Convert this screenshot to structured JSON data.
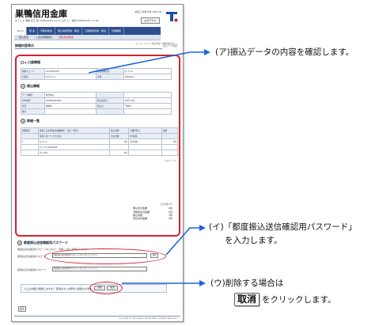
{
  "screen": {
    "bank_name": "巣鴨信用金庫",
    "header_small": "前回ご利用日時 WEB-TB",
    "sub_info": "ようこそ 巣鴨 花子 様 2008/04/02 14:14 ログイン 前回 2008/04/01 12:30",
    "logout_label": "ログアウト",
    "nav": [
      "メイン",
      "照 会",
      "手数料照会",
      "振込情報登録・照会",
      "口座振替登録・照会",
      "管理機能"
    ],
    "subnav": [
      "・振込照会",
      "・入金先明細照会",
      "・振込取消照会"
    ],
    "page_title": "詳細内容表示",
    "breadcrumb": "ホーム＞メイン＞振込照会＞詳細内容表示 ＞振込データ削除",
    "sections": {
      "account": {
        "title": "口座情報",
        "rows": [
          [
            "依頼人コード",
            "0123456789",
            "振込依頼者名",
            "ｽｶﾞﾓ ﾊﾅｺ"
          ],
          [
            "企業名",
            "ｶ)ｽｶﾞﾓｼﾝｷﾝ",
            "普通",
            "0000123"
          ]
        ]
      },
      "transfer": {
        "num": "1",
        "title": "振込情報",
        "rows": [
          [
            "データ種別",
            "総合振込",
            "",
            ""
          ],
          [
            "WEB番号",
            "200804020001",
            "振込指定日",
            "04月 05日"
          ],
          [
            "状況",
            "依頼中",
            "振込日",
            "予約済"
          ],
          [
            "備考",
            "",
            "",
            ""
          ]
        ]
      },
      "detail": {
        "num": "2",
        "title": "詳細一覧",
        "headers": [
          "明細番号",
          "受取人口座情報(金融機関名・支店・科目)",
          "振込金額",
          "手数料区分",
          "摘要"
        ],
        "subheaders": [
          "",
          "受取人名(フリガナ表示)",
          "支払金額",
          "EDI情報",
          ""
        ],
        "rows": [
          [
            "1",
            "ｽｶﾞﾓｼﾝｷﾝ",
            "0円",
            "当方負担",
            "0円"
          ],
          [
            "",
            "ﾎﾝﾃﾝ ﾌﾂｳ 0000795",
            "",
            "",
            ""
          ],
          [
            "",
            "ｽｶﾞﾓ ﾀﾛｳ",
            "0円",
            "",
            ""
          ]
        ],
        "page_info": "(1/1ページ)"
      },
      "totals": {
        "note": "合計件数 1件",
        "rows": [
          [
            "振込合計金額",
            "0円"
          ],
          [
            "手数料合計金額",
            "0円"
          ],
          [
            "振込件数",
            "1件"
          ],
          [
            "支払合計金額",
            "0円"
          ]
        ]
      },
      "password": {
        "num": "3",
        "title": "都度振込送信確認用パスワード",
        "instruction": "都度振込送信確認用パスワードを入力の上、「削除」ボタンを押してください。",
        "label1": "都度振込送信確認用パスワード",
        "placeholder1": "都度振込送信確認用パスワードを入力してください",
        "label2": "都度振込送信確認用パスワード",
        "placeholder2": "都度振込送信確認用パスワードを入力してください",
        "ok_label": "OK"
      }
    },
    "confirm_text": "以上の内容で削除しますか？ 取消ボタンを押すと削除されます。",
    "delete_label": "削除",
    "cancel_label": "取消",
    "back_label": "戻る",
    "footer": "Copyright (C) The Sugamo Shinkin Bank. All Rights Reserved."
  },
  "annotations": {
    "a": "(ア)振込データの内容を確認します。",
    "b_line1": "(イ)「都度振込送信確認用パスワード」",
    "b_line2": "を入力します。",
    "c_line1": "(ウ)削除する場合は",
    "c_button": "取消",
    "c_line2": "をクリックします。"
  },
  "colors": {
    "accent_red": "#d8202e",
    "arrow_blue": "#1e63d6",
    "nav_blue": "#2e4f8f"
  }
}
